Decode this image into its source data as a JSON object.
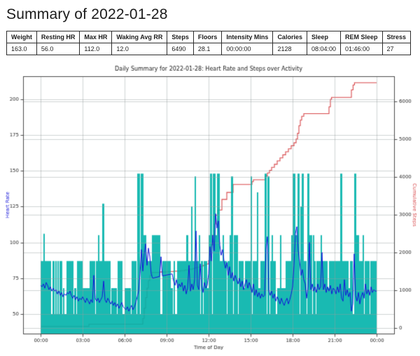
{
  "page": {
    "title": "Summary of 2022-01-28"
  },
  "summary_table": {
    "columns": [
      {
        "label": "Weight",
        "value": "163.0"
      },
      {
        "label": "Resting HR",
        "value": "56.0"
      },
      {
        "label": "Max HR",
        "value": "112.0"
      },
      {
        "label": "Waking Avg RR",
        "value": "12.0"
      },
      {
        "label": "Steps",
        "value": "6490"
      },
      {
        "label": "Floors",
        "value": "28.1"
      },
      {
        "label": "Intensity Mins",
        "value": "00:00:00"
      },
      {
        "label": "Calories",
        "value": "2128"
      },
      {
        "label": "Sleep",
        "value": "08:04:00"
      },
      {
        "label": "REM Sleep",
        "value": "01:46:00"
      },
      {
        "label": "Stress",
        "value": "27"
      }
    ]
  },
  "chart_data": {
    "type": "line",
    "title": "Daily Summary for 2022-01-28: Heart Rate and Steps over Activity",
    "xlabel": "Time of Day",
    "ylabel_left": "Heart Rate",
    "ylabel_right": "Cumulative Steps",
    "grid": true,
    "legend": "none",
    "x_range_hours": [
      -1.25,
      25.25
    ],
    "x_ticks": {
      "hours": [
        0,
        3,
        6,
        9,
        12,
        15,
        18,
        21,
        24
      ],
      "labels": [
        "00:00",
        "03:00",
        "06:00",
        "09:00",
        "12:00",
        "15:00",
        "18:00",
        "21:00",
        "00:00"
      ]
    },
    "y_left": {
      "range": [
        36.3,
        216.0
      ],
      "ticks": [
        50,
        75,
        100,
        125,
        150,
        175,
        200
      ]
    },
    "y_right": {
      "range": [
        -154,
        6661
      ],
      "ticks": [
        0,
        1000,
        2000,
        3000,
        4000,
        5000,
        6000
      ]
    },
    "colors": {
      "heart_rate": "#1414d9",
      "steps": "#d8474a",
      "activity_fill": "#00b2aa",
      "activity_alpha": 0.9,
      "grid": "rgba(150,158,158,0.45)",
      "spine": "#4a4a4a",
      "tick_text": "#262626",
      "title_text": "#1a1a1a"
    },
    "series": [
      {
        "name": "Activity",
        "type": "interval-fill",
        "axis": "left",
        "base_level": 50,
        "intervals": [
          [
            0.0,
            0.2,
            87
          ],
          [
            0.2,
            0.3,
            106
          ],
          [
            0.3,
            0.75,
            87
          ],
          [
            0.85,
            1.0,
            87
          ],
          [
            1.05,
            1.15,
            87
          ],
          [
            1.2,
            1.3,
            87
          ],
          [
            1.35,
            1.55,
            87
          ],
          [
            1.6,
            1.7,
            68
          ],
          [
            1.85,
            2.35,
            87
          ],
          [
            2.4,
            2.55,
            68
          ],
          [
            2.6,
            3.0,
            87
          ],
          [
            3.0,
            3.5,
            68
          ],
          [
            3.5,
            3.9,
            87
          ],
          [
            3.95,
            4.1,
            87
          ],
          [
            4.1,
            4.2,
            105
          ],
          [
            4.2,
            4.4,
            87
          ],
          [
            4.4,
            4.55,
            127
          ],
          [
            4.55,
            5.0,
            87
          ],
          [
            5.05,
            5.45,
            68
          ],
          [
            5.5,
            5.85,
            87
          ],
          [
            6.0,
            6.45,
            68
          ],
          [
            6.5,
            6.85,
            87
          ],
          [
            6.9,
            7.1,
            148
          ],
          [
            7.15,
            7.35,
            148
          ],
          [
            7.35,
            7.55,
            105
          ],
          [
            7.55,
            7.95,
            87
          ],
          [
            7.95,
            8.55,
            105
          ],
          [
            8.7,
            9.3,
            87
          ],
          [
            9.3,
            9.45,
            68
          ],
          [
            9.5,
            9.6,
            87
          ],
          [
            9.75,
            10.4,
            87
          ],
          [
            10.4,
            10.55,
            105
          ],
          [
            10.55,
            10.75,
            87
          ],
          [
            10.75,
            10.85,
            125
          ],
          [
            10.85,
            11.0,
            87
          ],
          [
            11.0,
            11.1,
            146
          ],
          [
            11.1,
            11.3,
            87
          ],
          [
            11.3,
            11.4,
            105
          ],
          [
            11.45,
            11.6,
            87
          ],
          [
            11.65,
            11.9,
            87
          ],
          [
            11.9,
            12.0,
            68
          ],
          [
            12.0,
            12.1,
            105
          ],
          [
            12.1,
            12.25,
            148
          ],
          [
            12.3,
            12.5,
            148
          ],
          [
            12.5,
            12.6,
            105
          ],
          [
            12.6,
            12.8,
            148
          ],
          [
            12.8,
            13.0,
            87
          ],
          [
            13.0,
            13.1,
            105
          ],
          [
            13.1,
            13.3,
            87
          ],
          [
            13.35,
            13.5,
            87
          ],
          [
            13.5,
            13.6,
            105
          ],
          [
            13.6,
            13.75,
            146
          ],
          [
            13.8,
            14.0,
            105
          ],
          [
            14.0,
            14.1,
            105
          ],
          [
            14.15,
            14.5,
            87
          ],
          [
            14.5,
            14.6,
            68
          ],
          [
            14.6,
            15.0,
            87
          ],
          [
            15.0,
            15.1,
            146
          ],
          [
            15.15,
            15.45,
            87
          ],
          [
            15.45,
            15.55,
            135
          ],
          [
            15.55,
            15.7,
            68
          ],
          [
            15.7,
            16.0,
            87
          ],
          [
            16.0,
            16.15,
            148
          ],
          [
            16.2,
            16.35,
            146
          ],
          [
            16.4,
            16.5,
            87
          ],
          [
            16.5,
            16.6,
            105
          ],
          [
            16.6,
            16.8,
            87
          ],
          [
            16.9,
            17.1,
            68
          ],
          [
            17.1,
            17.2,
            105
          ],
          [
            17.2,
            17.5,
            68
          ],
          [
            17.5,
            17.9,
            87
          ],
          [
            17.9,
            18.0,
            105
          ],
          [
            18.0,
            18.2,
            148
          ],
          [
            18.2,
            18.35,
            105
          ],
          [
            18.35,
            18.5,
            148
          ],
          [
            18.55,
            18.65,
            125
          ],
          [
            18.65,
            18.8,
            148
          ],
          [
            18.8,
            19.0,
            87
          ],
          [
            19.05,
            19.2,
            148
          ],
          [
            19.2,
            19.4,
            105
          ],
          [
            19.45,
            19.55,
            105
          ],
          [
            19.55,
            19.65,
            87
          ],
          [
            19.7,
            20.0,
            87
          ],
          [
            20.0,
            20.1,
            105
          ],
          [
            20.1,
            20.5,
            87
          ],
          [
            20.5,
            20.6,
            68
          ],
          [
            20.6,
            21.0,
            87
          ],
          [
            21.0,
            21.4,
            87
          ],
          [
            21.4,
            21.55,
            148
          ],
          [
            21.55,
            22.0,
            87
          ],
          [
            22.0,
            22.1,
            68
          ],
          [
            22.1,
            22.3,
            87
          ],
          [
            22.4,
            22.55,
            148
          ],
          [
            22.55,
            22.75,
            105
          ],
          [
            22.75,
            23.0,
            87
          ],
          [
            23.0,
            23.1,
            105
          ],
          [
            23.15,
            23.5,
            87
          ],
          [
            23.55,
            24.0,
            87
          ]
        ]
      },
      {
        "name": "Cumulative Steps",
        "type": "step",
        "axis": "right",
        "points": [
          [
            0,
            35
          ],
          [
            3.45,
            95
          ],
          [
            7.3,
            250
          ],
          [
            7.4,
            520
          ],
          [
            7.5,
            800
          ],
          [
            7.6,
            1050
          ],
          [
            7.7,
            1250
          ],
          [
            7.8,
            1380
          ],
          [
            7.95,
            1465
          ],
          [
            8.5,
            1478
          ],
          [
            9.0,
            1490
          ],
          [
            9.5,
            1500
          ],
          [
            10.0,
            1512
          ],
          [
            10.3,
            1532
          ],
          [
            10.6,
            1552
          ],
          [
            10.9,
            1578
          ],
          [
            11.1,
            1602
          ],
          [
            11.35,
            1628
          ],
          [
            11.6,
            1656
          ],
          [
            11.8,
            1688
          ],
          [
            12.0,
            1780
          ],
          [
            12.1,
            1950
          ],
          [
            12.2,
            2200
          ],
          [
            12.3,
            2450
          ],
          [
            12.4,
            2750
          ],
          [
            12.5,
            2980
          ],
          [
            12.65,
            3120
          ],
          [
            12.95,
            3400
          ],
          [
            13.3,
            3585
          ],
          [
            13.75,
            3795
          ],
          [
            15.1,
            3870
          ],
          [
            15.2,
            3920
          ],
          [
            16.05,
            4020
          ],
          [
            16.2,
            4100
          ],
          [
            16.35,
            4170
          ],
          [
            16.5,
            4250
          ],
          [
            16.7,
            4330
          ],
          [
            16.9,
            4420
          ],
          [
            17.1,
            4500
          ],
          [
            17.3,
            4580
          ],
          [
            17.5,
            4660
          ],
          [
            17.7,
            4740
          ],
          [
            17.9,
            4820
          ],
          [
            18.1,
            4900
          ],
          [
            18.25,
            5000
          ],
          [
            18.35,
            5150
          ],
          [
            18.45,
            5350
          ],
          [
            18.55,
            5500
          ],
          [
            18.65,
            5600
          ],
          [
            18.8,
            5670
          ],
          [
            20.6,
            5850
          ],
          [
            20.7,
            6050
          ],
          [
            20.78,
            6100
          ],
          [
            22.2,
            6300
          ],
          [
            22.32,
            6430
          ],
          [
            22.42,
            6490
          ],
          [
            24,
            6490
          ]
        ]
      },
      {
        "name": "Heart Rate",
        "type": "line",
        "axis": "left",
        "x_start": 0,
        "x_step": 0.1,
        "values": [
          70,
          69,
          71,
          68,
          72,
          70,
          67,
          69,
          66,
          68,
          66,
          67,
          64,
          66,
          63,
          65,
          62,
          64,
          63,
          65,
          64,
          66,
          63,
          61,
          63,
          60,
          62,
          59,
          61,
          60,
          62,
          60,
          58,
          61,
          59,
          57,
          60,
          58,
          77,
          61,
          59,
          61,
          58,
          60,
          62,
          73,
          60,
          58,
          61,
          59,
          57,
          59,
          56,
          58,
          55,
          57,
          54,
          56,
          58,
          55,
          54,
          53,
          55,
          52,
          54,
          56,
          53,
          55,
          58,
          62,
          66,
          78,
          95,
          80,
          92,
          99,
          84,
          96,
          90,
          78,
          75,
          75.2,
          75.5,
          75.7,
          76,
          76.2,
          90,
          76.6,
          76.8,
          77,
          77.2,
          77.4,
          77.6,
          77.8,
          78,
          73,
          70,
          74,
          68,
          71,
          69,
          72,
          66,
          70,
          64,
          68,
          84,
          66,
          71,
          67,
          74,
          108,
          70,
          67,
          85,
          69,
          65,
          72,
          68,
          70,
          78,
          97,
          87,
          105,
          94,
          120,
          110,
          115,
          98,
          91,
          95,
          87,
          82,
          86,
          77,
          83,
          75,
          79,
          73,
          77,
          74,
          71,
          75,
          69,
          73,
          67,
          71,
          74,
          68,
          72,
          69,
          65,
          71,
          63,
          67,
          62,
          65,
          61,
          64,
          62,
          63,
          95,
          104,
          67,
          63,
          66,
          61,
          64,
          59,
          62,
          60,
          57,
          61,
          58,
          56,
          59,
          61,
          57,
          60,
          64,
          69,
          84,
          106,
          111,
          94,
          87,
          77,
          81,
          74,
          71,
          61,
          69,
          100,
          67,
          71,
          66,
          69,
          65,
          71,
          67,
          69,
          93,
          67,
          71,
          65,
          69,
          66,
          70,
          64,
          68,
          67,
          64,
          69,
          65,
          71,
          61,
          59,
          74,
          63,
          67,
          62,
          65,
          52,
          57,
          92,
          63,
          59,
          65,
          57,
          62,
          65,
          61,
          71,
          64,
          67,
          63,
          69,
          65,
          67,
          66,
          66
        ]
      }
    ]
  }
}
